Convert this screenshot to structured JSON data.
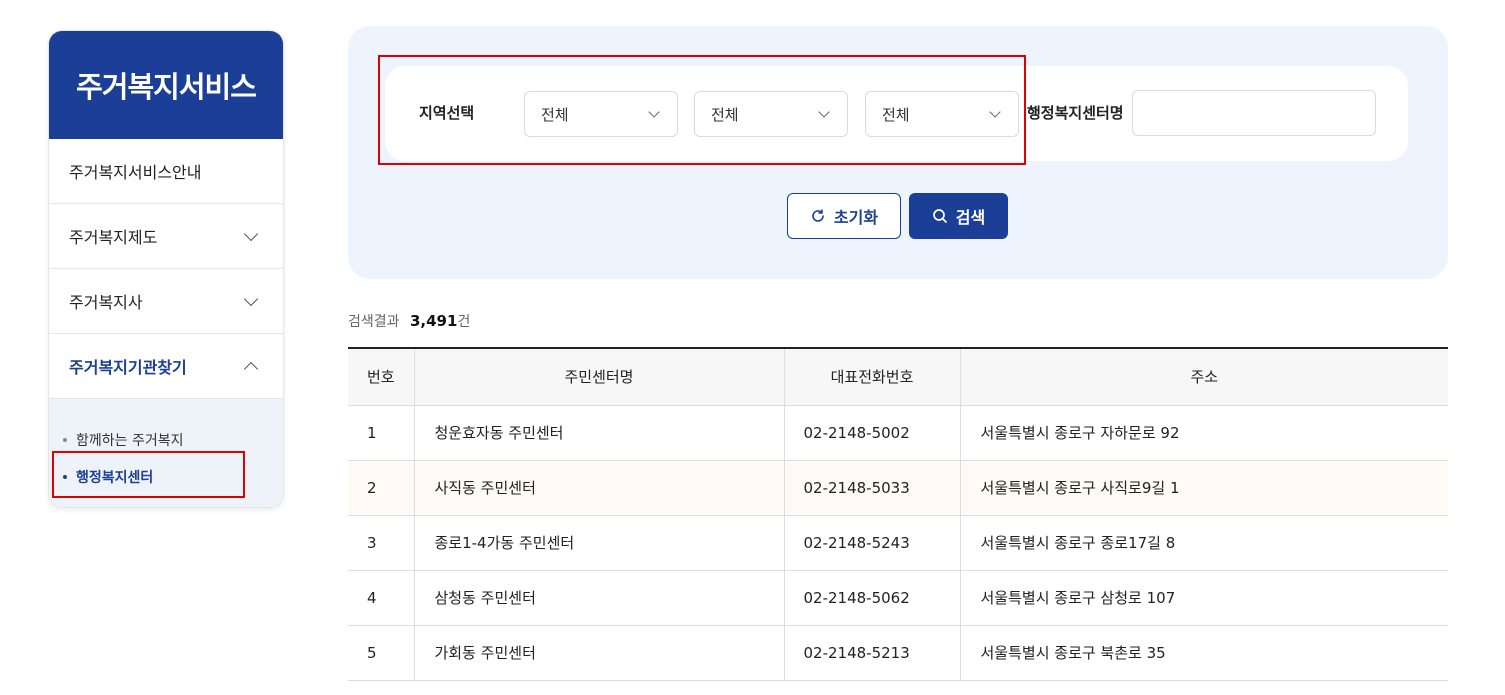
{
  "sidebar": {
    "title": "주거복지서비스",
    "items": [
      {
        "label": "주거복지서비스안내"
      },
      {
        "label": "주거복지제도"
      },
      {
        "label": "주거복지사"
      },
      {
        "label": "주거복지기관찾기"
      }
    ],
    "sub_items": [
      {
        "label": "함께하는 주거복지"
      },
      {
        "label": "행정복지센터"
      }
    ]
  },
  "search": {
    "region_label": "지역선택",
    "selects": [
      {
        "value": "전체"
      },
      {
        "value": "전체"
      },
      {
        "value": "전체"
      }
    ],
    "center_label": "행정복지센터명",
    "center_value": "",
    "reset_label": "초기화",
    "search_label": "검색"
  },
  "results": {
    "prefix": "검색결과",
    "count": "3,491",
    "suffix": "건"
  },
  "table": {
    "headers": [
      "번호",
      "주민센터명",
      "대표전화번호",
      "주소"
    ],
    "rows": [
      {
        "no": "1",
        "name": "청운효자동 주민센터",
        "tel": "02-2148-5002",
        "addr": "서울특별시 종로구 자하문로 92"
      },
      {
        "no": "2",
        "name": "사직동 주민센터",
        "tel": "02-2148-5033",
        "addr": "서울특별시 종로구 사직로9길 1"
      },
      {
        "no": "3",
        "name": "종로1-4가동 주민센터",
        "tel": "02-2148-5243",
        "addr": "서울특별시 종로구 종로17길 8"
      },
      {
        "no": "4",
        "name": "삼청동 주민센터",
        "tel": "02-2148-5062",
        "addr": "서울특별시 종로구 삼청로 107"
      },
      {
        "no": "5",
        "name": "가회동 주민센터",
        "tel": "02-2148-5213",
        "addr": "서울특별시 종로구 북촌로 35"
      }
    ]
  },
  "colors": {
    "brand": "#1b3f96",
    "highlight_box": "#e00000",
    "panel_bg": "#eef4fd",
    "row_alt": "#fffaf3"
  },
  "icons": {
    "reset": "refresh-icon",
    "search": "search-icon",
    "expand": "chevron-down-icon",
    "collapse": "chevron-up-icon"
  }
}
